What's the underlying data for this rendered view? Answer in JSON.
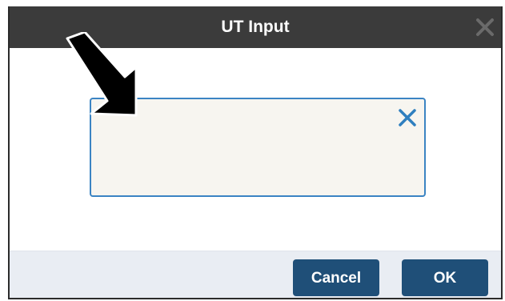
{
  "dialog": {
    "title": "UT Input",
    "title_close_icon": "close-icon"
  },
  "input": {
    "value": "",
    "placeholder": "",
    "clear_icon": "clear-icon"
  },
  "footer": {
    "cancel_label": "Cancel",
    "ok_label": "OK"
  },
  "colors": {
    "titlebar": "#3b3b3b",
    "input_border": "#3b84c3",
    "input_background": "#f7f5f0",
    "clear_icon": "#2f7fbf",
    "footer": "#e9edf3",
    "button": "#1f4f78",
    "annotation_arrow": "#000000"
  }
}
